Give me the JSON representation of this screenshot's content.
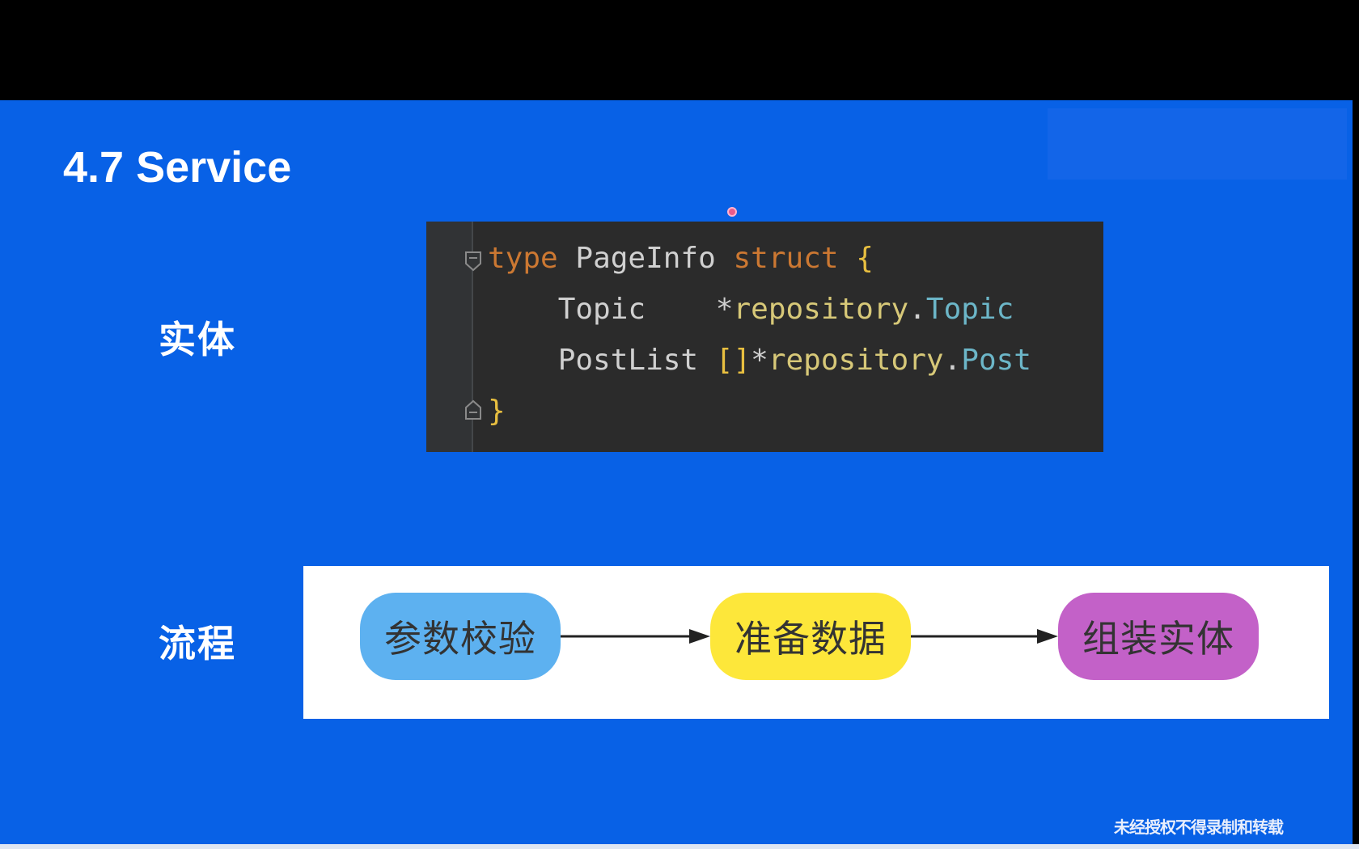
{
  "slide": {
    "title": "4.7 Service",
    "entity_label": "实体",
    "flow_label": "流程",
    "watermark": "未经授权不得录制和转载"
  },
  "code": {
    "line1": {
      "keyword_type": "type",
      "name": "PageInfo",
      "keyword_struct": "struct",
      "open_brace": "{"
    },
    "line2": {
      "field": "Topic",
      "star": "*",
      "pkg": "repository",
      "dot": ".",
      "type": "Topic"
    },
    "line3": {
      "field": "PostList",
      "brackets": "[]",
      "star": "*",
      "pkg": "repository",
      "dot": ".",
      "type": "Post"
    },
    "line4": {
      "close_brace": "}"
    }
  },
  "flow": {
    "steps": [
      "参数校验",
      "准备数据",
      "组装实体"
    ],
    "colors": [
      "#5db1f0",
      "#fde73a",
      "#c361c8"
    ]
  },
  "colors": {
    "slide_background": "#0861e6",
    "code_background": "#2b2b2b",
    "keyword": "#cc7832",
    "type_name": "#6cb6c8"
  }
}
